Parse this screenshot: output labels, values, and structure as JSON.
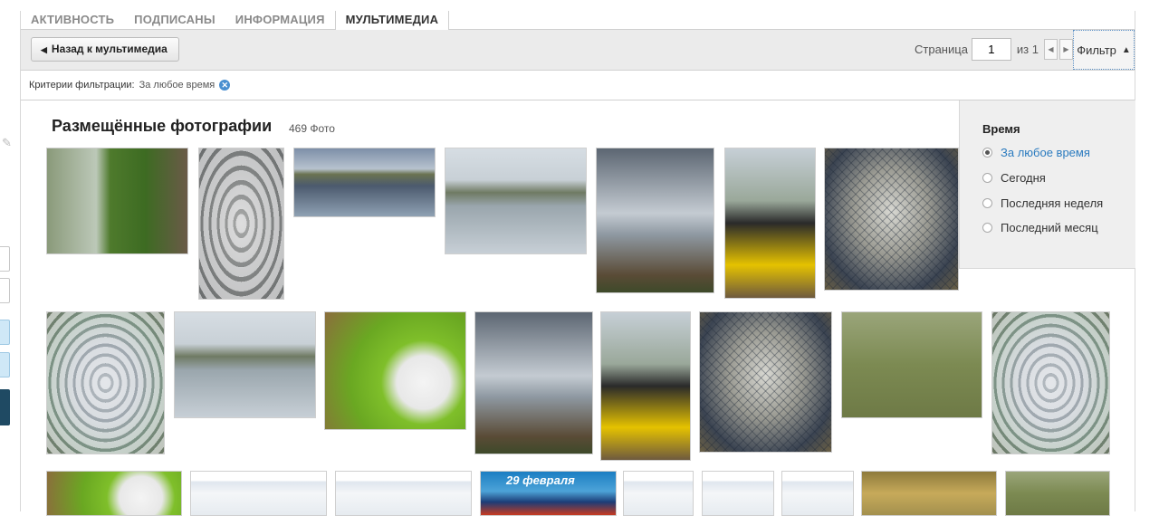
{
  "tabs": [
    {
      "label": "АКТИВНОСТЬ"
    },
    {
      "label": "ПОДПИСАНЫ"
    },
    {
      "label": "ИНФОРМАЦИЯ"
    },
    {
      "label": "МУЛЬТИМЕДИА"
    }
  ],
  "active_tab": "МУЛЬТИМЕДИА",
  "toolbar": {
    "back_label": "Назад к мультимедиа",
    "page_label": "Страница",
    "page_value": "1",
    "page_of": "из 1",
    "filter_label": "Фильтр"
  },
  "criteria": {
    "label": "Критерии фильтрации:",
    "value": "За любое время"
  },
  "gallery": {
    "title": "Размещённые фотографии",
    "count": "469 Фото"
  },
  "filter_panel": {
    "title": "Время",
    "options": [
      "За любое время",
      "Сегодня",
      "Последняя неделя",
      "Последний месяц"
    ],
    "selected": "За любое время"
  },
  "banner": {
    "text": "29 февраля"
  },
  "colors": {
    "link": "#2b7bbf",
    "accent": "#4a8fd0",
    "toolbar_bg": "#ebebeb",
    "panel_bg": "#efefef"
  }
}
